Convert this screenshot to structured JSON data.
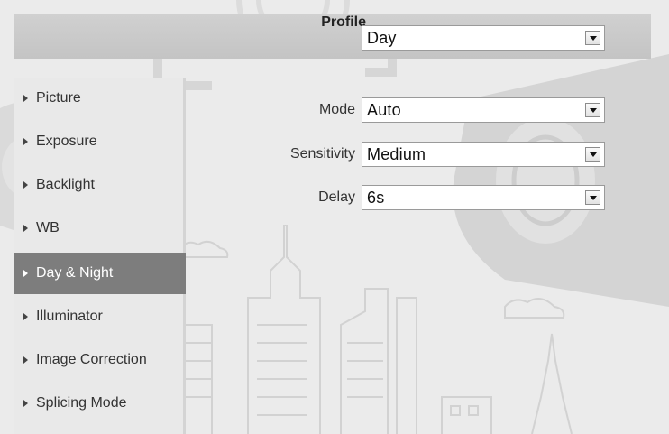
{
  "profile": {
    "label": "Profile",
    "value": "Day"
  },
  "sidebar": {
    "items": [
      {
        "label": "Picture",
        "active": false
      },
      {
        "label": "Exposure",
        "active": false
      },
      {
        "label": "Backlight",
        "active": false
      },
      {
        "label": "WB",
        "active": false
      },
      {
        "label": "Day & Night",
        "active": true
      },
      {
        "label": "Illuminator",
        "active": false
      },
      {
        "label": "Image Correction",
        "active": false
      },
      {
        "label": "Splicing Mode",
        "active": false
      }
    ]
  },
  "settings": {
    "mode": {
      "label": "Mode",
      "value": "Auto"
    },
    "sensitivity": {
      "label": "Sensitivity",
      "value": "Medium"
    },
    "delay": {
      "label": "Delay",
      "value": "6s"
    }
  },
  "colors": {
    "active_item": "#7d7d7d",
    "header_bar": "#c8c8c8",
    "background": "#ebebeb"
  }
}
